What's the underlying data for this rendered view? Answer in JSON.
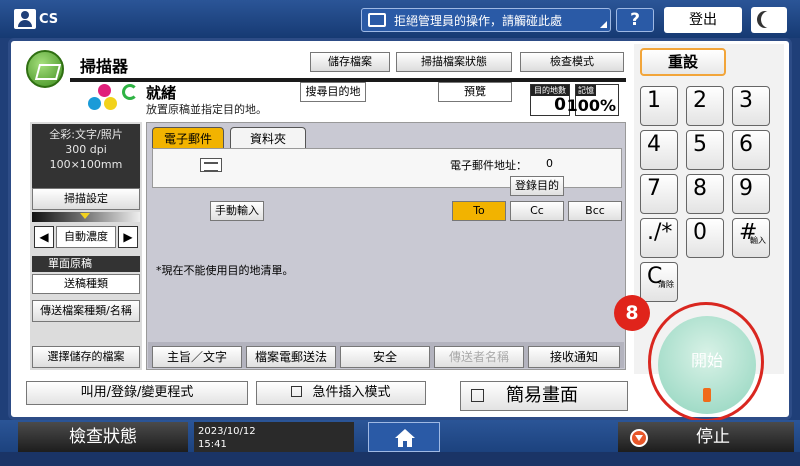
{
  "topbar": {
    "user": "CS",
    "message": "拒絕管理員的操作，請觸碰此處",
    "help": "?",
    "logout": "登出"
  },
  "header": {
    "title": "掃描器",
    "buttons": [
      "儲存檔案",
      "掃描檔案狀態",
      "檢查模式"
    ]
  },
  "status": {
    "state": "就緒",
    "message": "放置原稿並指定目的地。",
    "search_dest": "搜尋目的地",
    "preview": "預覽",
    "dest_count_label": "目的地數",
    "dest_count": "0",
    "memory_label": "記憶",
    "memory_value": "100%"
  },
  "left": {
    "settings_lines": [
      "全彩:文字/照片",
      "300 dpi",
      "100×100mm"
    ],
    "scan_settings": "掃描設定",
    "auto_density": "自動濃度",
    "single_original": "單面原稿",
    "send_type": "送稿種類",
    "file_type_name": "傳送檔案種類/名稱",
    "select_stored": "選擇儲存的檔案"
  },
  "tabs": [
    "電子郵件",
    "資料夾"
  ],
  "email": {
    "address_label": "電子郵件地址：",
    "address_count": "0",
    "register_dest": "登錄目的",
    "manual_input": "手動輸入",
    "to": "To",
    "cc": "Cc",
    "bcc": "Bcc",
    "notice": "*現在不能使用目的地清單。"
  },
  "bottom_menu": [
    "主旨／文字",
    "檔案電郵送法",
    "安全",
    "傳送者名稱",
    "接收通知"
  ],
  "keypad": {
    "reset": "重設",
    "keys": [
      "1",
      "2",
      "3",
      "4",
      "5",
      "6",
      "7",
      "8",
      "9",
      "./*",
      "0",
      "#"
    ],
    "hash_sub": "輸入",
    "clear": "C",
    "clear_sub": "清除"
  },
  "badge": "8",
  "start": "開始",
  "bottom_row": {
    "recall": "叫用/登錄/變更程式",
    "interrupt": "急件插入模式",
    "simple": "簡易畫面"
  },
  "footer": {
    "check_status": "檢查狀態",
    "date": "2023/10/12",
    "time": "15:41",
    "stop": "停止"
  }
}
